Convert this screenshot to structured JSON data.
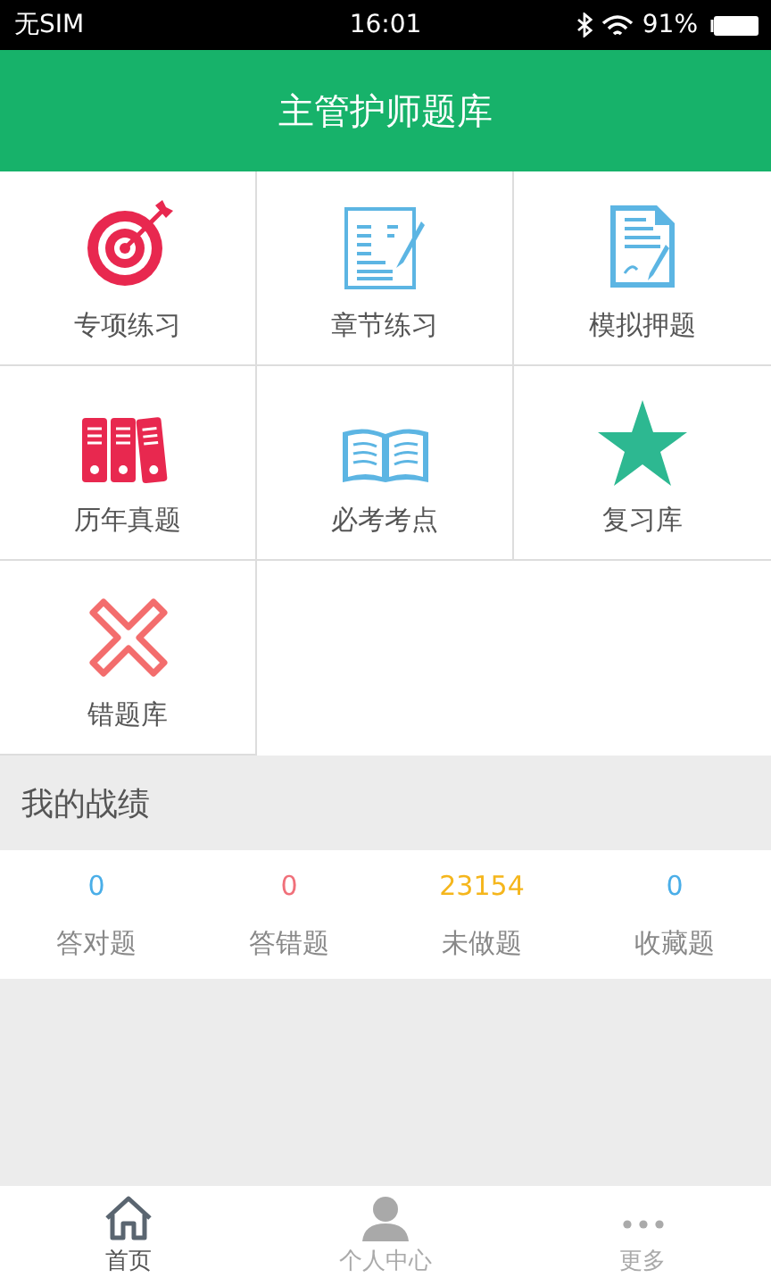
{
  "status_bar": {
    "carrier": "无SIM",
    "time": "16:01",
    "battery": "91%"
  },
  "header": {
    "title": "主管护师题库"
  },
  "tiles": [
    {
      "label": "专项练习",
      "kind": "target"
    },
    {
      "label": "章节练习",
      "kind": "document"
    },
    {
      "label": "模拟押题",
      "kind": "page"
    },
    {
      "label": "历年真题",
      "kind": "binders"
    },
    {
      "label": "必考考点",
      "kind": "book"
    },
    {
      "label": "复习库",
      "kind": "star"
    },
    {
      "label": "错题库",
      "kind": "cross"
    }
  ],
  "section": {
    "title": "我的战绩"
  },
  "stats": [
    {
      "value": "0",
      "label": "答对题",
      "color": "#4aaee8"
    },
    {
      "value": "0",
      "label": "答错题",
      "color": "#f0707a"
    },
    {
      "value": "23154",
      "label": "未做题",
      "color": "#f5b61c"
    },
    {
      "value": "0",
      "label": "收藏题",
      "color": "#4aaee8"
    }
  ],
  "tab_bar": [
    {
      "label": "首页",
      "kind": "home",
      "selected": true
    },
    {
      "label": "个人中心",
      "kind": "person",
      "selected": false
    },
    {
      "label": "更多",
      "kind": "more",
      "selected": false
    }
  ]
}
